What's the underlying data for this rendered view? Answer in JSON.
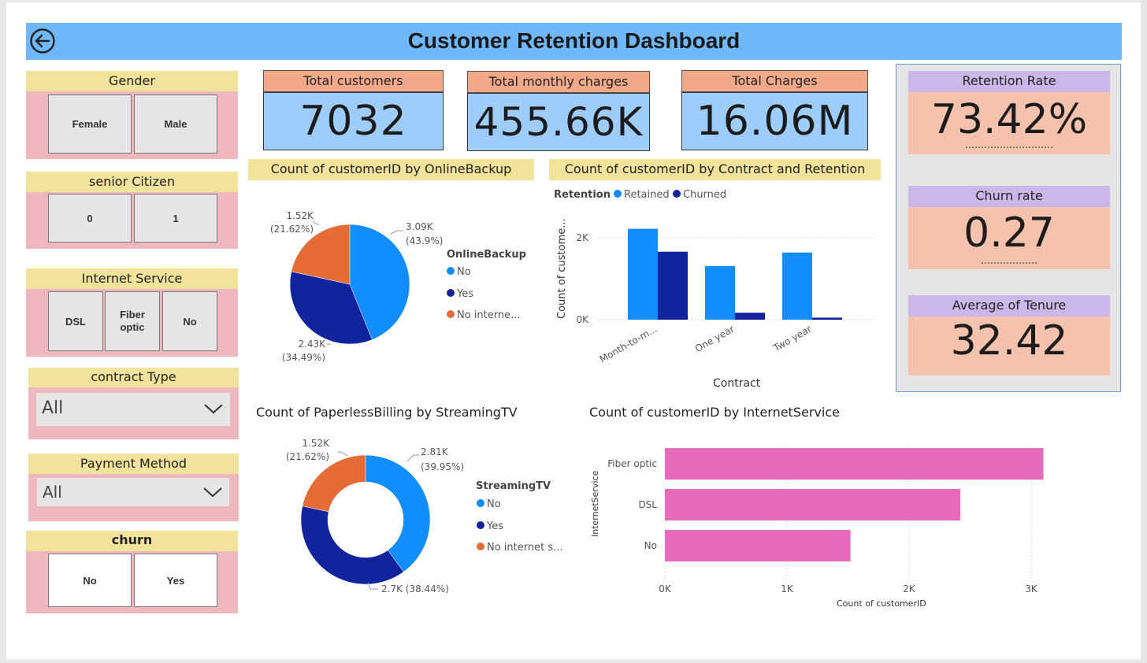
{
  "header": {
    "title": "Customer Retention Dashboard",
    "back_icon": "back-arrow-icon"
  },
  "slicers": {
    "gender": {
      "title": "Gender",
      "options": [
        "Female",
        "Male"
      ]
    },
    "senior": {
      "title": "senior Citizen",
      "options": [
        "0",
        "1"
      ]
    },
    "internet": {
      "title": "Internet Service",
      "options": [
        "DSL",
        "Fiber optic",
        "No"
      ]
    },
    "contract": {
      "title": "contract Type",
      "selected": "All"
    },
    "payment": {
      "title": "Payment Method",
      "selected": "All"
    },
    "churn": {
      "title": "churn",
      "options": [
        "No",
        "Yes"
      ]
    }
  },
  "kpis": {
    "total_customers": {
      "label": "Total customers",
      "value": "7032"
    },
    "monthly_charges": {
      "label": "Total monthly charges",
      "value": "455.66K"
    },
    "total_charges": {
      "label": "Total Charges",
      "value": "16.06M"
    }
  },
  "right_kpis": {
    "retention": {
      "label": "Retention Rate",
      "value": "73.42%"
    },
    "churn": {
      "label": "Churn rate",
      "value": "0.27"
    },
    "tenure": {
      "label": "Average of Tenure",
      "value": "32.42"
    }
  },
  "colors": {
    "header": "#6fb8fb",
    "no": "#118dff",
    "yes": "#12239e",
    "no_internet": "#e66c37",
    "bar_pink": "#e66bbc",
    "retained": "#118dff",
    "churned": "#12239e"
  },
  "chart_data": [
    {
      "type": "pie",
      "title": "Count of customerID by OnlineBackup",
      "legend_title": "OnlineBackup",
      "categories": [
        "No",
        "Yes",
        "No interne..."
      ],
      "values": [
        3090,
        2430,
        1520
      ],
      "data_labels": [
        [
          "3.09K",
          "(43.9%)"
        ],
        [
          "2.43K",
          "(34.49%)"
        ],
        [
          "1.52K",
          "(21.62%)"
        ]
      ]
    },
    {
      "type": "bar",
      "title": "Count of customerID by Contract and Retention",
      "legend_title": "Retention",
      "categories": [
        "Month-to-m...",
        "One year",
        "Two year"
      ],
      "series": [
        {
          "name": "Retained",
          "values": [
            2220,
            1310,
            1640
          ]
        },
        {
          "name": "Churned",
          "values": [
            1660,
            170,
            50
          ]
        }
      ],
      "xlabel": "Contract",
      "ylabel": "Count of custome...",
      "y_ticks": [
        "0K",
        "2K"
      ],
      "ylim": [
        0,
        2500
      ]
    },
    {
      "type": "pie",
      "title": "Count of PaperlessBilling by StreamingTV",
      "legend_title": "StreamingTV",
      "categories": [
        "No",
        "Yes",
        "No internet s..."
      ],
      "values": [
        2810,
        2700,
        1520
      ],
      "data_labels": [
        [
          "2.81K",
          "(39.95%)"
        ],
        [
          "2.7K (38.44%)"
        ],
        [
          "1.52K",
          "(21.62%)"
        ]
      ]
    },
    {
      "type": "bar",
      "title": "Count of customerID by InternetService",
      "categories": [
        "Fiber optic",
        "DSL",
        "No"
      ],
      "values": [
        3100,
        2420,
        1520
      ],
      "xlabel": "Count of customerID",
      "ylabel": "InternetService",
      "x_ticks": [
        "0K",
        "1K",
        "2K",
        "3K"
      ],
      "xlim": [
        0,
        3000
      ]
    }
  ]
}
